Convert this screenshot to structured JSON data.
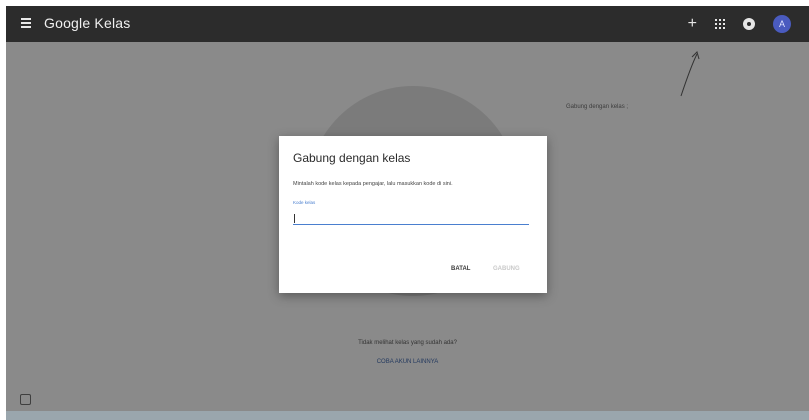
{
  "app": {
    "title": "Google Kelas"
  },
  "topbar": {
    "add_symbol": "+",
    "avatar_initial": "A"
  },
  "hint": {
    "text": "Gabung dengan kelas ;"
  },
  "dialog": {
    "title": "Gabung dengan kelas",
    "instruction": "Mintalah kode kelas kepada pengajar, lalu masukkan kode di sini.",
    "field_label": "Kode kelas",
    "input_value": "",
    "cancel_label": "BATAL",
    "join_label": "GABUNG"
  },
  "empty_state": {
    "message": "Tidak melihat kelas yang sudah ada?",
    "link": "COBA AKUN LAINNYA"
  },
  "colors": {
    "topbar": "#2c2c2c",
    "accent": "#4a7fcf",
    "avatar": "#4a5bbf"
  }
}
